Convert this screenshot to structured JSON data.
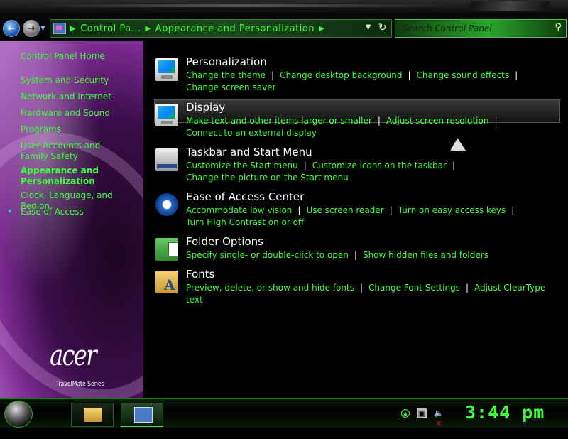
{
  "nav": {
    "address_crumbs": [
      "Control Pa...",
      "Appearance and Personalization"
    ],
    "search_placeholder": "Search Control Panel"
  },
  "sidebar": {
    "items": [
      {
        "label": "Control Panel Home"
      },
      {
        "label": "System and Security"
      },
      {
        "label": "Network and Internet"
      },
      {
        "label": "Hardware and Sound"
      },
      {
        "label": "Programs"
      },
      {
        "label": "User Accounts and Family Safety"
      },
      {
        "label": "Appearance and Personalization"
      },
      {
        "label": "Clock, Language, and Region"
      },
      {
        "label": "Ease of Access"
      }
    ],
    "brand": "acer",
    "brand_sub": "TravelMate Series"
  },
  "categories": [
    {
      "title": "Personalization",
      "icon": "monitor-icon",
      "links": [
        "Change the theme",
        "Change desktop background",
        "Change sound effects",
        "Change screen saver"
      ]
    },
    {
      "title": "Display",
      "icon": "display-icon",
      "links": [
        "Make text and other items larger or smaller",
        "Adjust screen resolution",
        "Connect to an external display"
      ]
    },
    {
      "title": "Taskbar and Start Menu",
      "icon": "taskbar-icon",
      "links": [
        "Customize the Start menu",
        "Customize icons on the taskbar",
        "Change the picture on the Start menu"
      ]
    },
    {
      "title": "Ease of Access Center",
      "icon": "ease-of-access-icon",
      "links": [
        "Accommodate low vision",
        "Use screen reader",
        "Turn on easy access keys",
        "Turn High Contrast on or off"
      ]
    },
    {
      "title": "Folder Options",
      "icon": "folder-options-icon",
      "links": [
        "Specify single- or double-click to open",
        "Show hidden files and folders"
      ]
    },
    {
      "title": "Fonts",
      "icon": "fonts-icon",
      "links": [
        "Preview, delete, or show and hide fonts",
        "Change Font Settings",
        "Adjust ClearType text"
      ]
    }
  ],
  "taskbar": {
    "clock": "3:44 pm"
  },
  "colors": {
    "accent": "#3cff3c",
    "background": "#000000"
  }
}
